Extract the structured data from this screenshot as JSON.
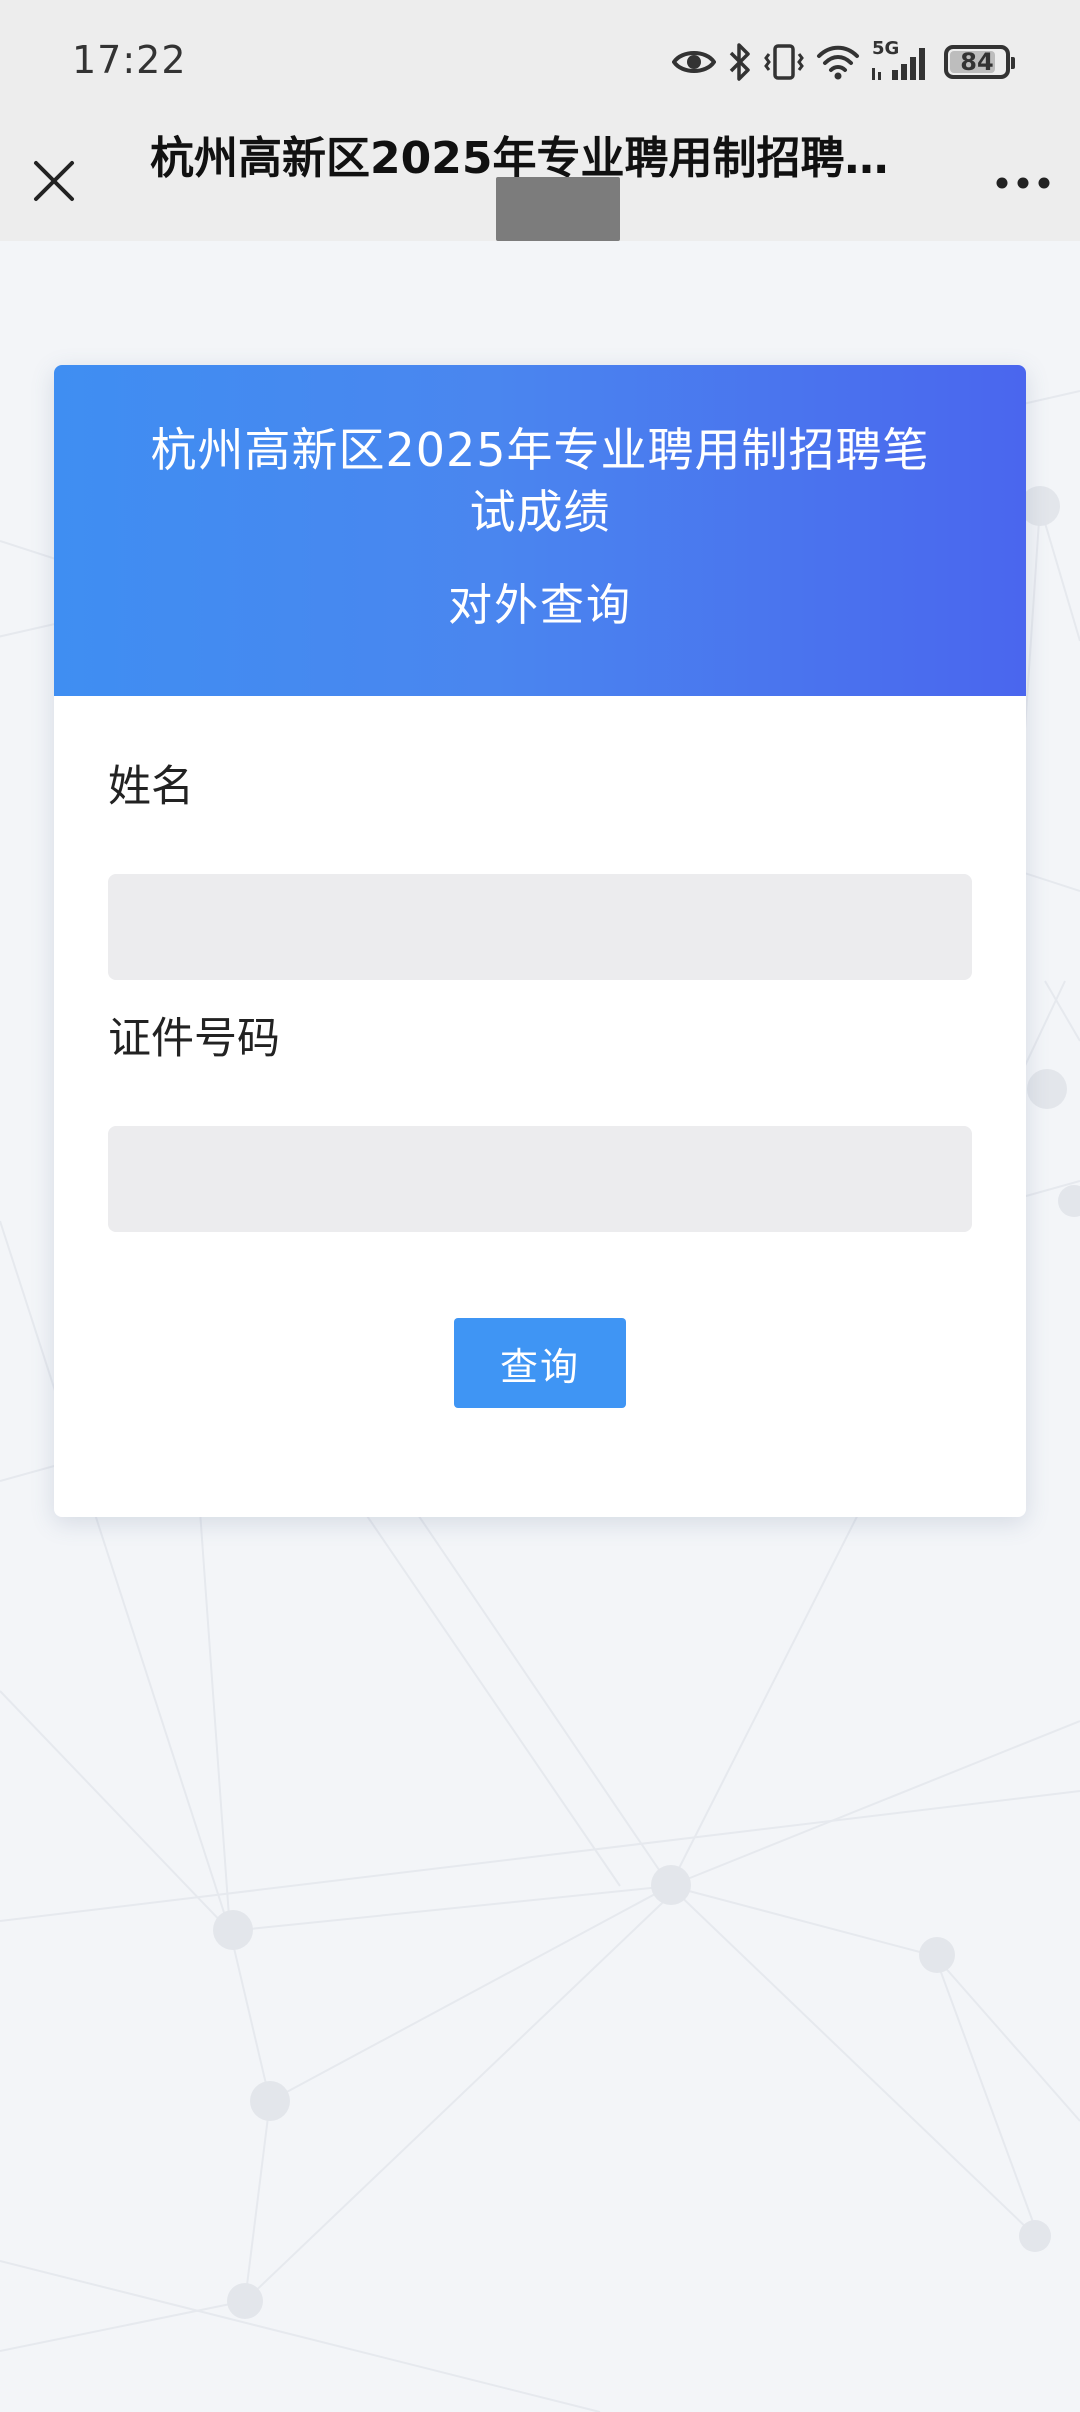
{
  "status_bar": {
    "time": "17:22",
    "network": "5G",
    "battery": "84",
    "battery_level": 0.84,
    "icons": [
      "eye-icon",
      "bluetooth-icon",
      "vibrate-icon",
      "wifi-icon",
      "signal-icon",
      "battery-icon"
    ]
  },
  "nav": {
    "title": "杭州高新区2025年专业聘用制招聘...",
    "close_icon": "close-icon",
    "more_icon": "more-icon"
  },
  "card": {
    "title": "杭州高新区2025年专业聘用制招聘笔试成绩",
    "subtitle": "对外查询",
    "header_gradient": [
      "#3f8ef2",
      "#4a66ee"
    ]
  },
  "form": {
    "name_label": "姓名",
    "name_value": "",
    "id_label": "证件号码",
    "id_value": "",
    "submit_label": "查询"
  },
  "colors": {
    "button": "#3f95f4",
    "input_bg": "#ececee",
    "page_bg": "#f3f5f8"
  }
}
